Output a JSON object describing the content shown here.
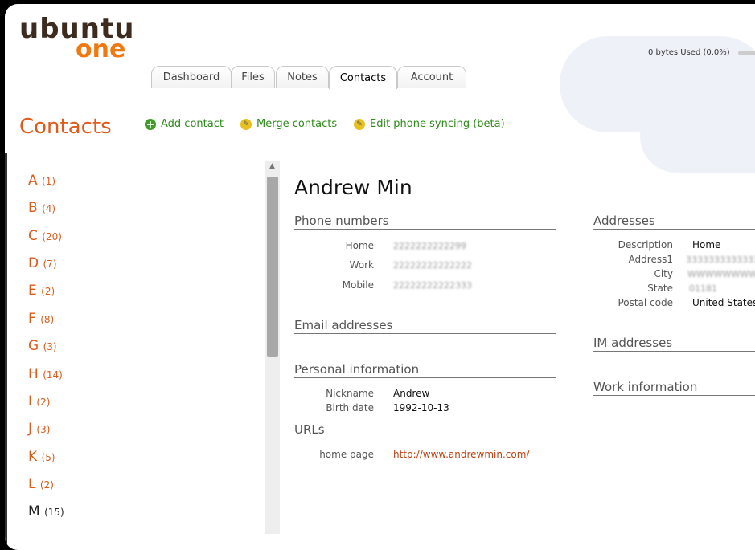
{
  "logo": {
    "line1": "ubuntu",
    "line2": "one"
  },
  "usage": {
    "text": "0 bytes Used (0.0%)",
    "fraction": 0.0
  },
  "tabs": [
    {
      "label": "Dashboard"
    },
    {
      "label": "Files"
    },
    {
      "label": "Notes"
    },
    {
      "label": "Contacts"
    },
    {
      "label": "Account"
    }
  ],
  "active_tab": "Contacts",
  "page_title": "Contacts",
  "actions": [
    {
      "label": "Add contact",
      "icon": "add-icon"
    },
    {
      "label": "Merge contacts",
      "icon": "edit-icon"
    },
    {
      "label": "Edit phone syncing (beta)",
      "icon": "edit-icon"
    }
  ],
  "letters": [
    {
      "letter": "A",
      "count": "(1)"
    },
    {
      "letter": "B",
      "count": "(4)"
    },
    {
      "letter": "C",
      "count": "(20)"
    },
    {
      "letter": "D",
      "count": "(7)"
    },
    {
      "letter": "E",
      "count": "(2)"
    },
    {
      "letter": "F",
      "count": "(8)"
    },
    {
      "letter": "G",
      "count": "(3)"
    },
    {
      "letter": "H",
      "count": "(14)"
    },
    {
      "letter": "I",
      "count": "(2)"
    },
    {
      "letter": "J",
      "count": "(3)"
    },
    {
      "letter": "K",
      "count": "(5)"
    },
    {
      "letter": "L",
      "count": "(2)"
    },
    {
      "letter": "M",
      "count": "(15)"
    }
  ],
  "contact": {
    "name": "Andrew Min",
    "phone_heading": "Phone numbers",
    "phones": [
      {
        "label": "Home",
        "value": "2222222222299"
      },
      {
        "label": "Work",
        "value": "22222222222222"
      },
      {
        "label": "Mobile",
        "value": "22222222222333"
      }
    ],
    "email_heading": "Email addresses",
    "personal_heading": "Personal information",
    "personal": [
      {
        "label": "Nickname",
        "value": "Andrew"
      },
      {
        "label": "Birth date",
        "value": "1992-10-13"
      }
    ],
    "urls_heading": "URLs",
    "urls": [
      {
        "label": "home page",
        "value": "http://www.andrewmin.com/"
      }
    ],
    "addresses_heading": "Addresses",
    "address": [
      {
        "label": "Description",
        "value": "Home"
      },
      {
        "label": "Address1",
        "value": "33333333333333"
      },
      {
        "label": "City",
        "value": "WWWWWWWW"
      },
      {
        "label": "State",
        "value": "01181"
      },
      {
        "label": "Postal code",
        "value": "United States"
      }
    ],
    "im_heading": "IM addresses",
    "work_heading": "Work information"
  }
}
